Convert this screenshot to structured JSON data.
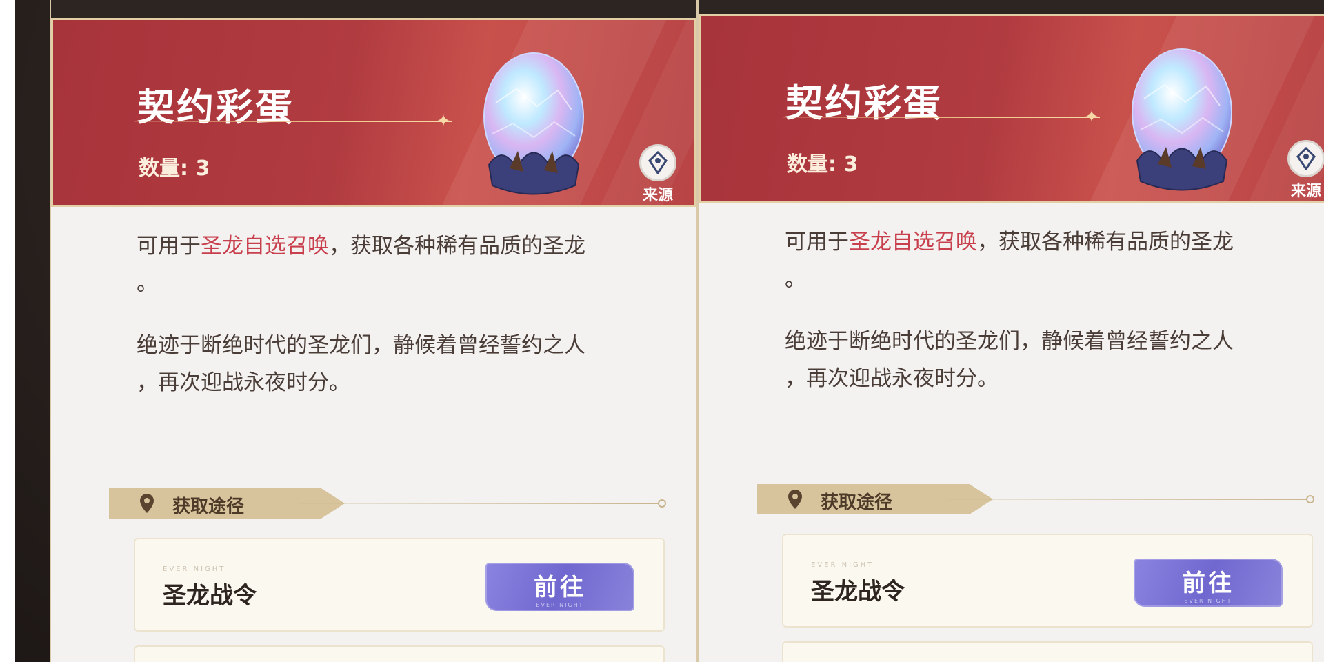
{
  "panels": [
    {
      "title": "契约彩蛋",
      "count": "数量: 3",
      "source_label": "来源",
      "desc_pre": "可用于",
      "desc_highlight": "圣龙自选召唤",
      "desc_post": "，获取各种稀有品质的圣龙",
      "desc_end": "。",
      "lore_line1": "绝迹于断绝时代的圣龙们，静候着曾经誓约之人",
      "lore_line2": "，再次迎战永夜时分。",
      "route_label": "获取途径",
      "card_tiny": "EVER NIGHT",
      "card_title": "圣龙战令",
      "go_label": "前往",
      "go_sub": "EVER NIGHT"
    },
    {
      "title": "契约彩蛋",
      "count": "数量: 3",
      "source_label": "来源",
      "desc_pre": "可用于",
      "desc_highlight": "圣龙自选召唤",
      "desc_post": "，获取各种稀有品质的圣龙",
      "desc_end": "。",
      "lore_line1": "绝迹于断绝时代的圣龙们，静候着曾经誓约之人",
      "lore_line2": "，再次迎战永夜时分。",
      "route_label": "获取途径",
      "card_tiny": "EVER NIGHT",
      "card_title": "圣龙战令",
      "go_label": "前往",
      "go_sub": "EVER NIGHT"
    }
  ],
  "colors": {
    "header_red": "#b03b40",
    "highlight": "#c8404d",
    "button_purple": "#7068cf",
    "banner_gold": "#d8c49c"
  },
  "icons": [
    "egg-item-icon",
    "location-pin-icon",
    "source-pin-icon"
  ]
}
